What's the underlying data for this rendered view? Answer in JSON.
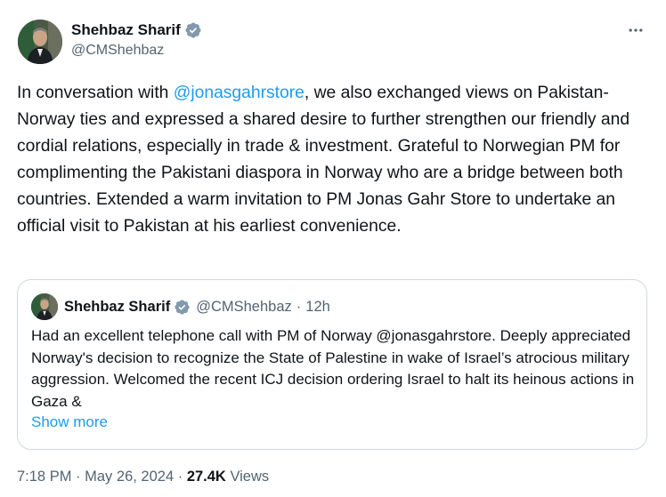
{
  "tweet": {
    "author_name": "Shehbaz Sharif",
    "author_handle": "@CMShehbaz",
    "text_before_mention": "In conversation with ",
    "mention": "@jonasgahrstore",
    "text_after_mention": ", we also exchanged views on Pakistan-Norway ties and expressed a shared desire to further strengthen our friendly and cordial relations, especially in trade & investment. Grateful to Norwegian PM for complimenting the Pakistani diaspora in Norway who are a bridge between both countries. Extended a warm invitation to PM Jonas Gahr Store to undertake an official visit to Pakistan at his earliest convenience.",
    "more_icon": "more-horizontal-icon",
    "verified_icon": "verified-badge-icon"
  },
  "quote": {
    "author_name": "Shehbaz Sharif",
    "author_handle": "@CMShehbaz",
    "separator": "·",
    "time": "12h",
    "text": "Had an excellent telephone call with PM of Norway @jonasgahrstore. Deeply appreciated Norway's decision to recognize the State of Palestine in wake of Israel’s atrocious military aggression. Welcomed the recent ICJ decision ordering Israel to halt its heinous actions in Gaza &",
    "show_more": "Show more"
  },
  "meta": {
    "time": "7:18 PM",
    "separator": "·",
    "date": "May 26, 2024",
    "views_count": "27.4K",
    "views_label": "Views"
  },
  "colors": {
    "accent": "#1d9bf0",
    "text_primary": "#0f1419",
    "text_secondary": "#536471",
    "border": "#cfd9de"
  }
}
